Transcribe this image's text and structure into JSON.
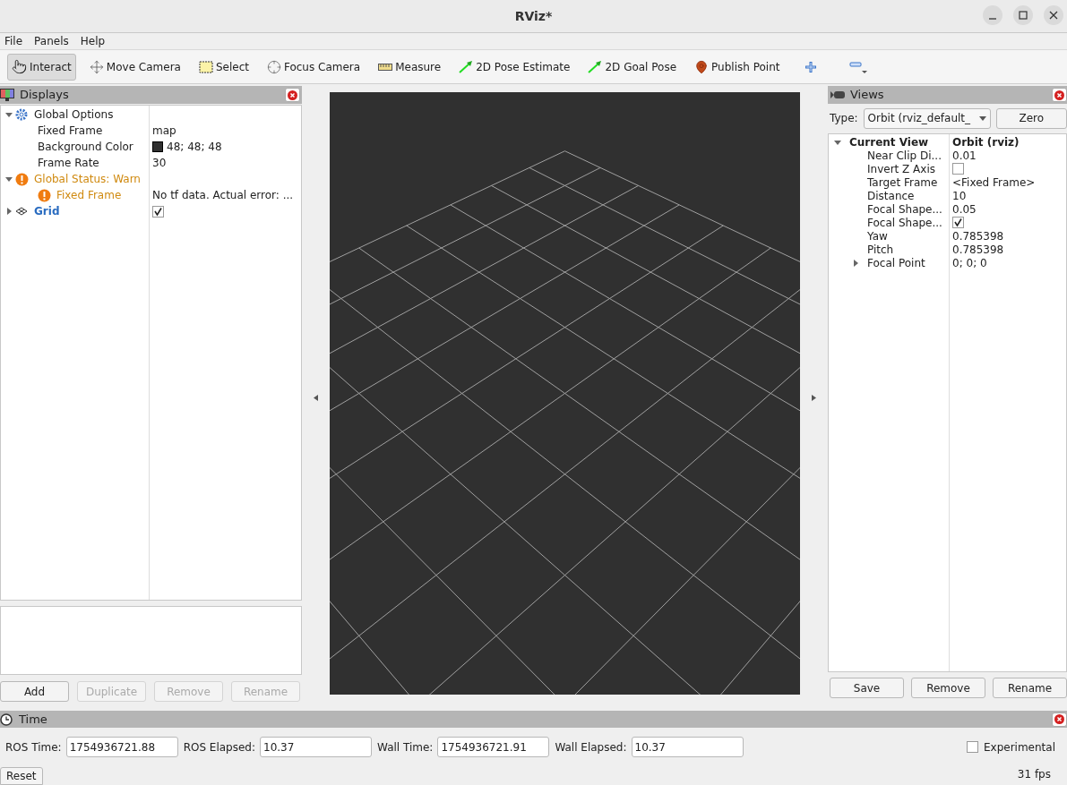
{
  "window": {
    "title": "RViz*"
  },
  "menu": [
    "File",
    "Panels",
    "Help"
  ],
  "tools": [
    {
      "kind": "interact",
      "label": "Interact",
      "selected": true
    },
    {
      "kind": "move",
      "label": "Move Camera",
      "selected": false
    },
    {
      "kind": "select",
      "label": "Select",
      "selected": false
    },
    {
      "kind": "focus",
      "label": "Focus Camera",
      "selected": false
    },
    {
      "kind": "measure",
      "label": "Measure",
      "selected": false
    },
    {
      "kind": "pose",
      "label": "2D Pose Estimate",
      "selected": false
    },
    {
      "kind": "pose",
      "label": "2D Goal Pose",
      "selected": false
    },
    {
      "kind": "point",
      "label": "Publish Point",
      "selected": false
    },
    {
      "kind": "add",
      "selected": false
    },
    {
      "kind": "remove",
      "selected": false
    }
  ],
  "displays": {
    "title": "Displays",
    "tree": [
      {
        "kind": "options",
        "label": "Global Options",
        "warning": false,
        "expanded": true,
        "children": [
          {
            "kind": "text",
            "label": "Fixed Frame",
            "value": "map",
            "warning": false
          },
          {
            "kind": "color",
            "label": "Background Color",
            "value": "48; 48; 48",
            "color": "#303030",
            "warning": false
          },
          {
            "kind": "text",
            "label": "Frame Rate",
            "value": "30",
            "warning": false
          }
        ]
      },
      {
        "kind": "status",
        "label": "Global Status: Warn",
        "warning": true,
        "expanded": true,
        "children": [
          {
            "kind": "status",
            "label": "Fixed Frame",
            "value": "No tf data.  Actual error: ...",
            "warning": true
          }
        ]
      },
      {
        "kind": "grid",
        "label": "Grid",
        "warning": false,
        "expanded": false,
        "checked": true
      }
    ],
    "buttons": [
      {
        "label": "Add",
        "disabled": false
      },
      {
        "label": "Duplicate",
        "disabled": true
      },
      {
        "label": "Remove",
        "disabled": true
      },
      {
        "label": "Rename",
        "disabled": true
      }
    ]
  },
  "views": {
    "title": "Views",
    "type_label": "Type:",
    "type_value": "Orbit (rviz_default_",
    "zero_button": "Zero",
    "tree": [
      {
        "kind": "header",
        "label": "Current View",
        "value": "Orbit (rviz)",
        "expanded": true,
        "children": [
          {
            "kind": "text",
            "label": "Near Clip Di...",
            "value": "0.01"
          },
          {
            "kind": "checkbox",
            "label": "Invert Z Axis",
            "checked": false
          },
          {
            "kind": "text",
            "label": "Target Frame",
            "value": "<Fixed Frame>"
          },
          {
            "kind": "text",
            "label": "Distance",
            "value": "10"
          },
          {
            "kind": "text",
            "label": "Focal Shape...",
            "value": "0.05"
          },
          {
            "kind": "checkbox",
            "label": "Focal Shape...",
            "checked": true
          },
          {
            "kind": "text",
            "label": "Yaw",
            "value": "0.785398"
          },
          {
            "kind": "text",
            "label": "Pitch",
            "value": "0.785398"
          },
          {
            "kind": "text",
            "label": "Focal Point",
            "value": "0; 0; 0",
            "expanded": false
          }
        ]
      }
    ],
    "buttons": [
      {
        "label": "Save",
        "disabled": false
      },
      {
        "label": "Remove",
        "disabled": false
      },
      {
        "label": "Rename",
        "disabled": false
      }
    ]
  },
  "time": {
    "title": "Time",
    "fields": [
      {
        "label": "ROS Time:",
        "value": "1754936721.88"
      },
      {
        "label": "ROS Elapsed:",
        "value": "10.37"
      },
      {
        "label": "Wall Time:",
        "value": "1754936721.91"
      },
      {
        "label": "Wall Elapsed:",
        "value": "10.37"
      }
    ],
    "experimental": {
      "label": "Experimental",
      "checked": false
    },
    "reset_button": "Reset",
    "fps": "31 fps"
  }
}
